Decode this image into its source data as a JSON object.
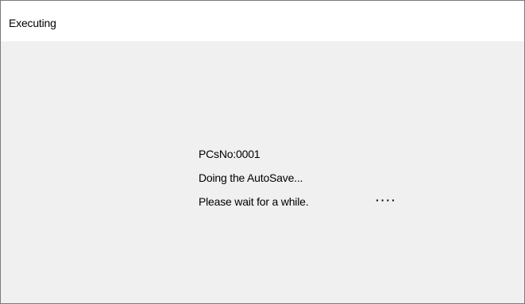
{
  "window": {
    "title": "Executing"
  },
  "message": {
    "line1": "PCsNo:0001",
    "line2": "Doing the AutoSave...",
    "line3": "Please wait for a while.",
    "progress_dots": "····"
  }
}
